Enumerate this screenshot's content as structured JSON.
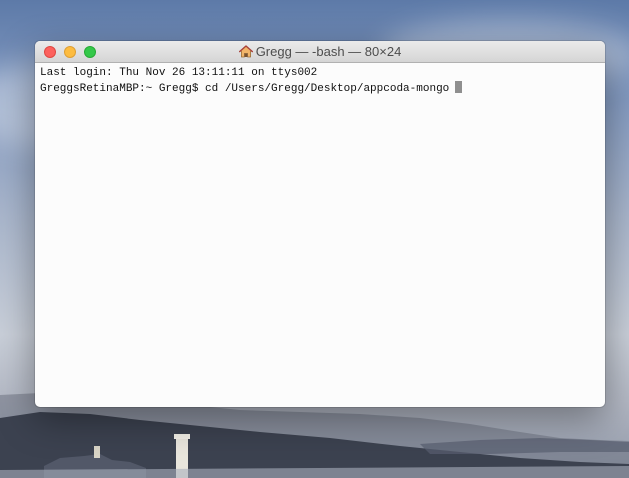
{
  "window": {
    "title": "Gregg — -bash — 80×24",
    "title_icon": "home-icon"
  },
  "terminal": {
    "lines": [
      "Last login: Thu Nov 26 13:11:11 on ttys002",
      "GreggsRetinaMBP:~ Gregg$ cd /Users/Gregg/Desktop/appcoda-mongo"
    ]
  },
  "colors": {
    "close": "#fc615d",
    "minimize": "#fdbc40",
    "maximize": "#34c84a",
    "terminal_background": "#fcfcfc",
    "terminal_text": "#111111",
    "cursor": "#8f8f8f"
  }
}
